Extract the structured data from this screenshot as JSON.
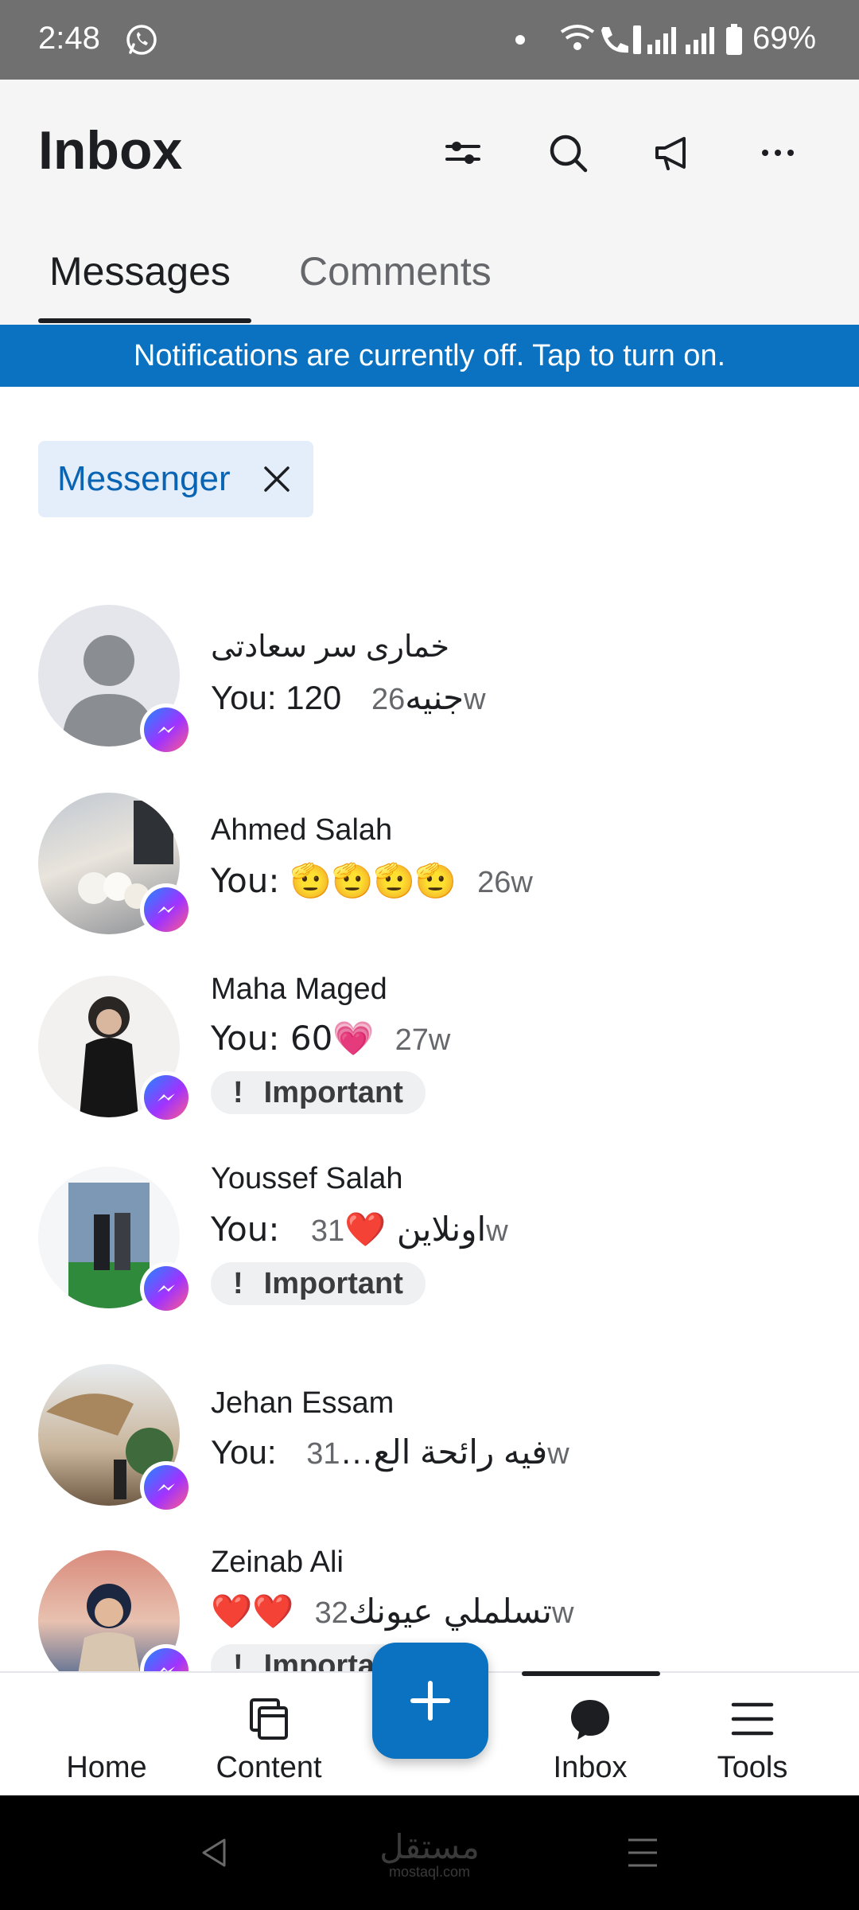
{
  "status_bar": {
    "time": "2:48",
    "battery": "69%"
  },
  "header": {
    "title": "Inbox",
    "tabs": [
      {
        "label": "Messages"
      },
      {
        "label": "Comments"
      }
    ],
    "icons": [
      "filter-sliders-icon",
      "search-icon",
      "megaphone-icon",
      "more-options-icon"
    ]
  },
  "notification": {
    "text": "Notifications are currently off. Tap to turn on."
  },
  "filter_chip": {
    "label": "Messenger"
  },
  "conversations": [
    {
      "name": "خمارى سر سعادتى",
      "preview": "You: 120 جنيه",
      "time": "26w",
      "important": false,
      "avatar": "default"
    },
    {
      "name": "Ahmed Salah",
      "preview": "You: 🫡🫡🫡🫡",
      "time": "26w",
      "important": false,
      "avatar": "photo"
    },
    {
      "name": "Maha Maged",
      "preview": "You: 60💗",
      "time": "27w",
      "important": true,
      "avatar": "photo"
    },
    {
      "name": "Youssef Salah",
      "preview": "You: اونلاين ❤️",
      "time": "31w",
      "important": true,
      "avatar": "photo"
    },
    {
      "name": "Jehan Essam",
      "preview": "You: فيه رائحة الع…",
      "time": "31w",
      "important": false,
      "avatar": "photo"
    },
    {
      "name": "Zeinab Ali",
      "preview": "❤️❤️تسلملي عيونك",
      "time": "32w",
      "important": true,
      "avatar": "photo"
    }
  ],
  "important_label": "Important",
  "important_mark": "!",
  "bottom_nav": [
    {
      "label": "Home"
    },
    {
      "label": "Content"
    },
    {
      "label": "Inbox"
    },
    {
      "label": "Tools"
    }
  ],
  "watermark": {
    "text": "مستقل",
    "sub": "mostaql.com"
  },
  "colors": {
    "accent": "#0a72c1",
    "chip_bg": "#e3eefa",
    "header_bg": "#f4f5f4"
  }
}
